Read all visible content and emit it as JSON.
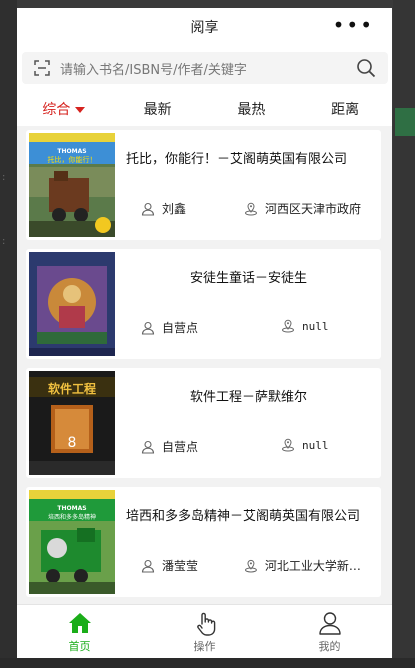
{
  "app": {
    "title": "阅享"
  },
  "search": {
    "placeholder": "请输入书名/ISBN号/作者/关键字"
  },
  "tabs": [
    {
      "label": "综合",
      "active": true
    },
    {
      "label": "最新",
      "active": false
    },
    {
      "label": "最热",
      "active": false
    },
    {
      "label": "距离",
      "active": false
    }
  ],
  "books": [
    {
      "title": "托比，你能行！－艾阁萌英国有限公司",
      "owner": "刘鑫",
      "location": "河西区天津市政府"
    },
    {
      "title": "安徒生童话－安徒生",
      "owner": "自营点",
      "location": "null"
    },
    {
      "title": "软件工程－萨默维尔",
      "owner": "自营点",
      "location": "null"
    },
    {
      "title": "培西和多多岛精神－艾阁萌英国有限公司",
      "owner": "潘莹莹",
      "location": "河北工业大学新校区"
    }
  ],
  "covers": {
    "book1": {
      "series": "THOMAS",
      "caption": "托比，你能行！"
    },
    "book3": {
      "caption": "软件工程"
    },
    "book4": {
      "series": "THOMAS",
      "caption": "培西和多多岛精神"
    }
  },
  "bottom_nav": [
    {
      "label": "首页",
      "active": true
    },
    {
      "label": "操作",
      "active": false
    },
    {
      "label": "我的",
      "active": false
    }
  ],
  "colors": {
    "accent_red": "#d6231f",
    "active_green": "#1aad19"
  }
}
